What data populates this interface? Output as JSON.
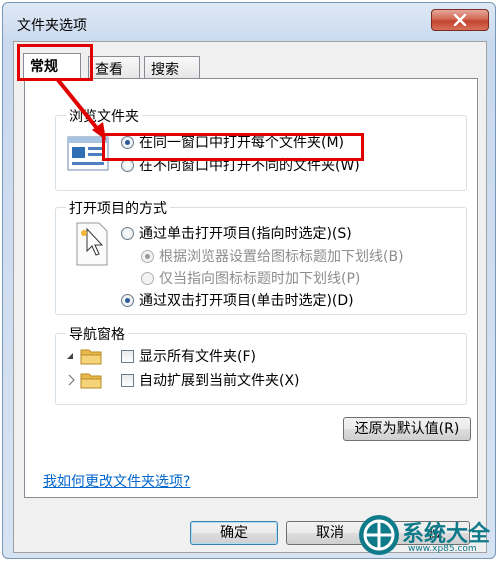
{
  "window": {
    "title": "文件夹选项"
  },
  "tabs": [
    {
      "label": "常规",
      "active": true
    },
    {
      "label": "查看"
    },
    {
      "label": "搜索"
    }
  ],
  "browse": {
    "group_label": "浏览文件夹",
    "options": [
      {
        "label": "在同一窗口中打开每个文件夹(M)",
        "selected": true
      },
      {
        "label": "在不同窗口中打开不同的文件夹(W)",
        "selected": false
      }
    ]
  },
  "click": {
    "group_label": "打开项目的方式",
    "single": "通过单击打开项目(指向时选定)(S)",
    "underline_browser": "根据浏览器设置给图标标题加下划线(B)",
    "underline_hover": "仅当指向图标标题时加下划线(P)",
    "double": "通过双击打开项目(单击时选定)(D)"
  },
  "nav": {
    "group_label": "导航窗格",
    "show_all": "显示所有文件夹(F)",
    "auto_expand": "自动扩展到当前文件夹(X)"
  },
  "restore_label": "还原为默认值(R)",
  "help_link": "我如何更改文件夹选项?",
  "footer": {
    "ok_label": "确定",
    "cancel_label": "取消",
    "apply_prefix": "应"
  },
  "watermark": {
    "brand": "系统大全",
    "url": "www.xp85.com"
  },
  "colors": {
    "highlight": "#e00000",
    "link": "#0066cc",
    "accent": "#2a5a9a"
  }
}
